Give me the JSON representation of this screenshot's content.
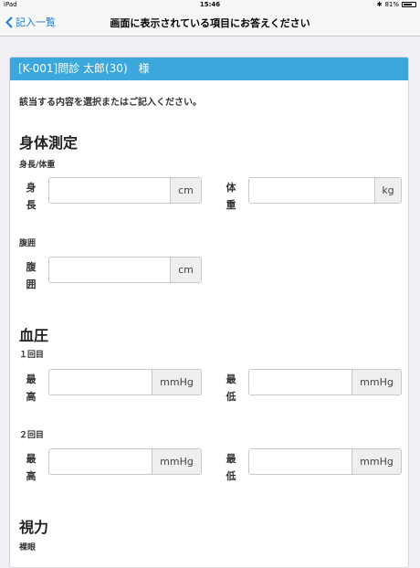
{
  "status_bar": {
    "device": "iPad",
    "time": "15:46",
    "battery_text": "81%",
    "battery_level": 0.81
  },
  "nav": {
    "back_label": "記入一覧",
    "title": "画面に表示されている項目にお答えください"
  },
  "panel": {
    "header": "[K-001]問診 太郎(30)　様",
    "instruction": "該当する内容を選択またはご記入ください。"
  },
  "body_measurement": {
    "title": "身体測定",
    "height_weight_label": "身長/体重",
    "height": {
      "label_top": "身",
      "label_bottom": "長",
      "value": "",
      "unit": "cm"
    },
    "weight": {
      "label_top": "体",
      "label_bottom": "重",
      "value": "",
      "unit": "kg"
    },
    "waist_label": "腹囲",
    "waist": {
      "label_top": "腹",
      "label_bottom": "囲",
      "value": "",
      "unit": "cm"
    }
  },
  "blood_pressure": {
    "title": "血圧",
    "first_label": "１回目",
    "first": {
      "max": {
        "label_top": "最",
        "label_bottom": "高",
        "value": "",
        "unit": "mmHg"
      },
      "min": {
        "label_top": "最",
        "label_bottom": "低",
        "value": "",
        "unit": "mmHg"
      }
    },
    "second_label": "２回目",
    "second": {
      "max": {
        "label_top": "最",
        "label_bottom": "高",
        "value": "",
        "unit": "mmHg"
      },
      "min": {
        "label_top": "最",
        "label_bottom": "低",
        "value": "",
        "unit": "mmHg"
      }
    }
  },
  "vision": {
    "title": "視力",
    "naked_eye_label": "裸眼"
  },
  "colors": {
    "header_bg": "#3ba7dc",
    "link": "#1a7bd6",
    "page_bg": "#efeff4"
  }
}
